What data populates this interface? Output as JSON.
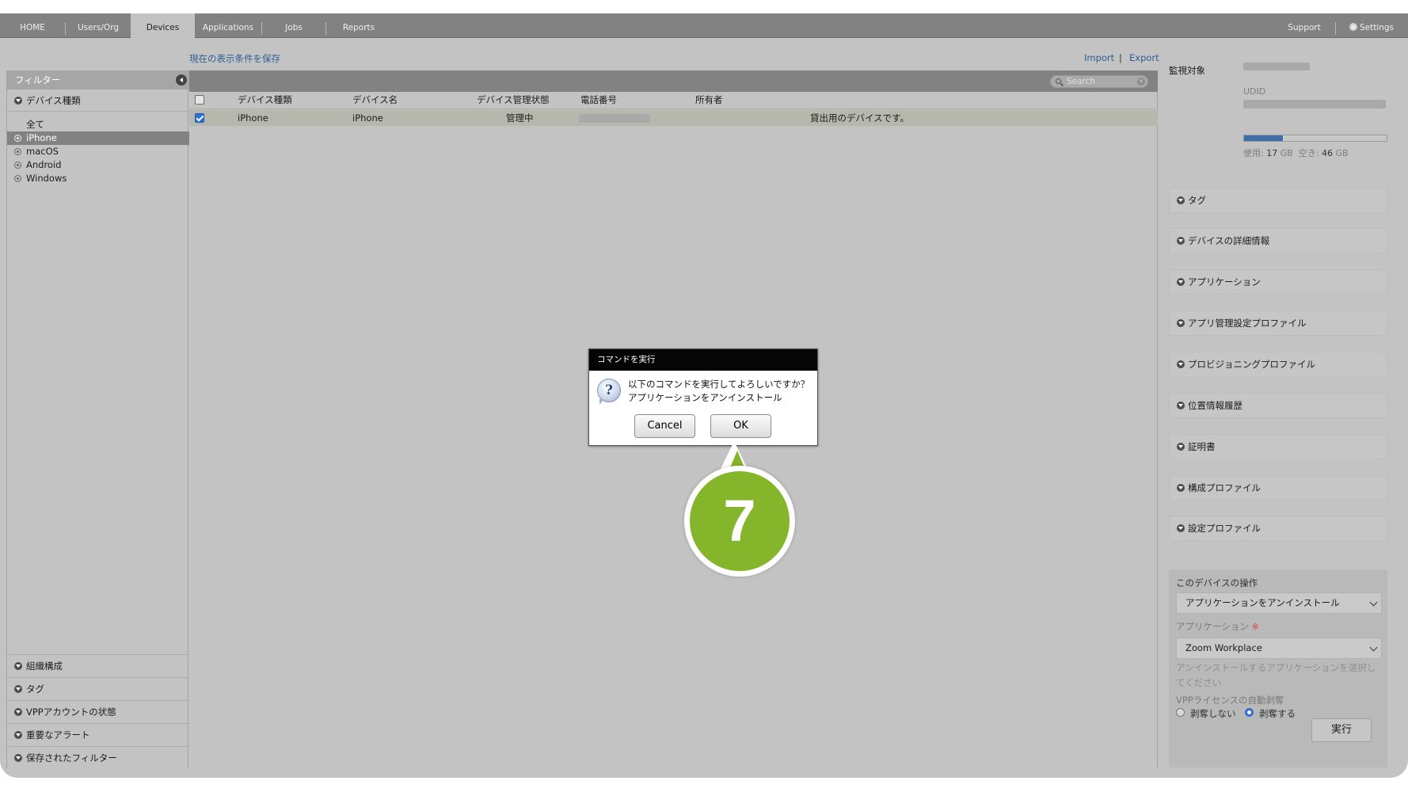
{
  "nav": {
    "tabs": [
      "HOME",
      "Users/Org",
      "Devices",
      "Applications",
      "Jobs",
      "Reports"
    ],
    "active_tab": "Devices",
    "support": "Support",
    "settings": "Settings"
  },
  "header": {
    "save_view": "現在の表示条件を保存",
    "import": "Import",
    "separator": "|",
    "export": "Export"
  },
  "filter": {
    "title": "フィルター",
    "device_type_section": "デバイス種類",
    "options": [
      "全て",
      "iPhone",
      "macOS",
      "Android",
      "Windows"
    ],
    "selected": "iPhone",
    "bottom_sections": [
      "組織構成",
      "タグ",
      "VPPアカウントの状態",
      "重要なアラート",
      "保存されたフィルター"
    ]
  },
  "table": {
    "search_placeholder": "Search",
    "columns": [
      "デバイス種類",
      "デバイス名",
      "デバイス管理状態",
      "電話番号",
      "所有者"
    ],
    "rows": [
      {
        "device_type": "iPhone",
        "device_name": "iPhone",
        "status": "管理中",
        "phone": "",
        "owner": "",
        "note": "貸出用のデバイスです。",
        "checked": true
      }
    ]
  },
  "details": {
    "supervised_label": "監視対象",
    "udid_label": "UDID",
    "storage": {
      "used_label": "使用:",
      "used_value": "17",
      "free_label": "空き:",
      "free_value": "46",
      "unit": "GB",
      "used_fraction": 0.27
    },
    "sections": [
      "タグ",
      "デバイスの詳細情報",
      "アプリケーション",
      "アプリ管理設定プロファイル",
      "プロビジョニングプロファイル",
      "位置情報履歴",
      "証明書",
      "構成プロファイル",
      "設定プロファイル"
    ],
    "operations": {
      "title": "このデバイスの操作",
      "command_value": "アプリケーションをアンインストール",
      "app_label": "アプリケーション",
      "required_mark": "※",
      "app_value": "Zoom Workplace",
      "app_hint": "アンインストールするアプリケーションを選択してください",
      "vpp_label": "VPPライセンスの自動剥奪",
      "vpp_options": [
        "剥奪しない",
        "剥奪する"
      ],
      "vpp_selected": "剥奪する",
      "execute": "実行"
    }
  },
  "dialog": {
    "title": "コマンドを実行",
    "line1": "以下のコマンドを実行してよろしいですか？",
    "line2": "アプリケーションをアンインストール",
    "cancel": "Cancel",
    "ok": "OK"
  },
  "callout": {
    "number": "7",
    "color": "#84b52a"
  }
}
